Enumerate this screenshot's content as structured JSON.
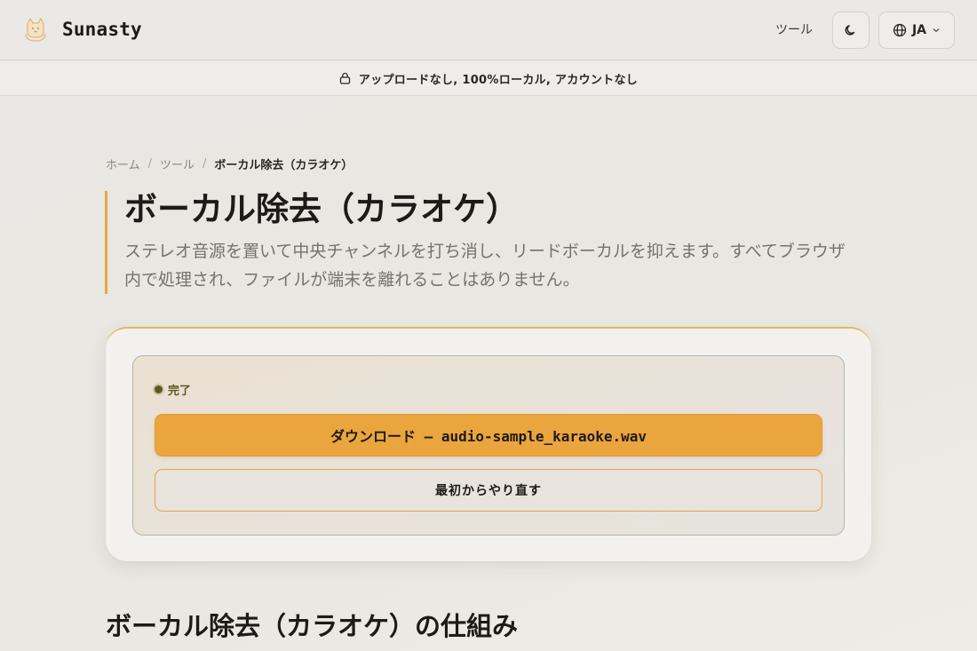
{
  "header": {
    "brand_name": "Sunasty",
    "nav_tools": "ツール",
    "lang_label": "JA"
  },
  "banner": {
    "text": "アップロードなし, 100%ローカル, アカウントなし"
  },
  "breadcrumb": {
    "items": [
      "ホーム",
      "ツール"
    ],
    "current": "ボーカル除去（カラオケ）"
  },
  "page": {
    "title": "ボーカル除去（カラオケ）",
    "description": "ステレオ音源を置いて中央チャンネルを打ち消し、リードボーカルを抑えます。すべてブラウザ内で処理され、ファイルが端末を離れることはありません。"
  },
  "result": {
    "status": "完了",
    "download_label": "ダウンロード — audio-sample_karaoke.wav",
    "restart_label": "最初からやり直す"
  },
  "section": {
    "title": "ボーカル除去（カラオケ）の仕組み"
  },
  "colors": {
    "accent": "#eba53e",
    "status": "#5b5a1f"
  }
}
